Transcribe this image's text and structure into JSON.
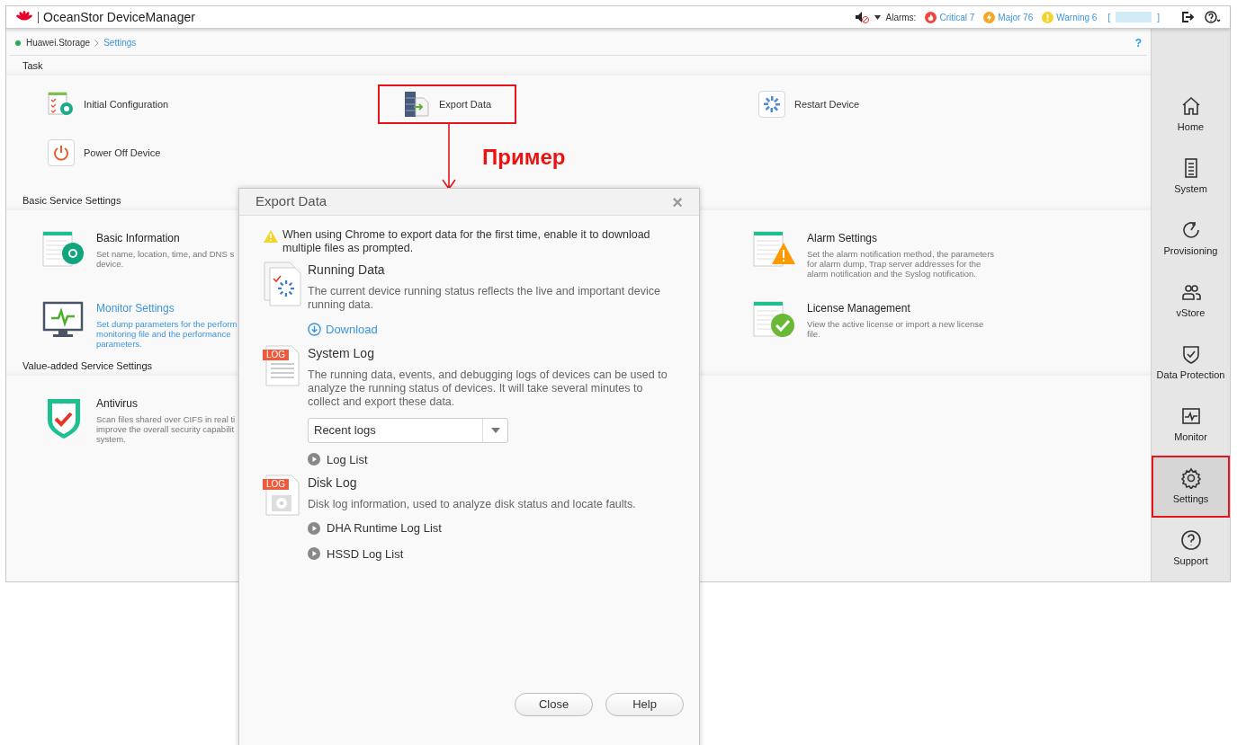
{
  "header": {
    "product": "OceanStor DeviceManager",
    "alarms_label": "Alarms:",
    "alarms": [
      {
        "kind": "critical",
        "label": "Critical 7"
      },
      {
        "kind": "major",
        "label": "Major 76"
      },
      {
        "kind": "warning",
        "label": "Warning 6"
      }
    ],
    "account": {
      "prefix": "[",
      "suffix": "]"
    }
  },
  "breadcrumb": {
    "items": [
      "Huawei.Storage",
      "Settings"
    ],
    "help": "?"
  },
  "sections": [
    {
      "title": "Task",
      "rows": [
        {
          "left": {
            "title": "Initial Configuration"
          },
          "middle": {
            "title": "Export Data",
            "annotated": true
          },
          "right": {
            "title": "Restart Device"
          }
        },
        {
          "left": {
            "title": "Power Off Device"
          }
        }
      ]
    },
    {
      "title": "Basic Service Settings",
      "rows": [
        {
          "left": {
            "title": "Basic Information",
            "highlighted": false,
            "description": [
              "Set name, location, time, and DNS s",
              "device."
            ]
          },
          "right": {
            "title": "Alarm Settings",
            "highlighted": false,
            "description": [
              "Set the alarm notification method, the parameters",
              "for alarm dump, Trap server addresses for the",
              "alarm notification and the Syslog notification."
            ]
          }
        },
        {
          "left": {
            "title": "Monitor Settings",
            "highlighted": true,
            "description": [
              "Set dump parameters for the perform",
              "monitoring file and the performance",
              "parameters."
            ]
          },
          "right": {
            "title": "License Management",
            "highlighted": false,
            "description": [
              "View the active license or import a new license",
              "file."
            ]
          }
        }
      ]
    },
    {
      "title": "Value-added Service Settings",
      "rows": [
        {
          "left": {
            "title": "Antivirus",
            "highlighted": false,
            "description": [
              "Scan files shared over CIFS in real ti",
              "improve the overall security capabilit",
              "system."
            ]
          }
        }
      ]
    }
  ],
  "nav": [
    {
      "label": "Home",
      "selected": false,
      "annotated": false
    },
    {
      "label": "System",
      "selected": false,
      "annotated": false
    },
    {
      "label": "Provisioning",
      "selected": false,
      "annotated": false
    },
    {
      "label": "vStore",
      "selected": false,
      "annotated": false
    },
    {
      "label": "Data Protection",
      "selected": false,
      "annotated": false
    },
    {
      "label": "Monitor",
      "selected": false,
      "annotated": false
    },
    {
      "label": "Settings",
      "selected": true,
      "annotated": true
    },
    {
      "label": "Support",
      "selected": false,
      "annotated": false
    }
  ],
  "annotation": {
    "label": "Пример"
  },
  "dialog": {
    "title": "Export Data",
    "close": "×",
    "notice": "When using Chrome to export data for the first time, enable it to download multiple files as prompted.",
    "sections": [
      {
        "title": "Running Data",
        "description": "The current device running status reflects the live and important device running data.",
        "actions": [
          {
            "kind": "download",
            "label": "Download"
          }
        ]
      },
      {
        "title": "System Log",
        "badge": "LOG",
        "description": "The running data, events, and debugging logs of devices can be used to analyze the running status of devices. It will take several minutes to collect and export these data.",
        "actions": [
          {
            "kind": "select",
            "label": "Recent logs"
          },
          {
            "kind": "expander",
            "label": "Log List"
          }
        ]
      },
      {
        "title": "Disk Log",
        "badge": "LOG",
        "description": "Disk log information, used to analyze disk status and locate faults.",
        "actions": [
          {
            "kind": "expander",
            "label": "DHA Runtime Log List"
          },
          {
            "kind": "expander",
            "label": "HSSD Log List"
          }
        ]
      }
    ],
    "buttons": [
      "Close",
      "Help"
    ]
  }
}
